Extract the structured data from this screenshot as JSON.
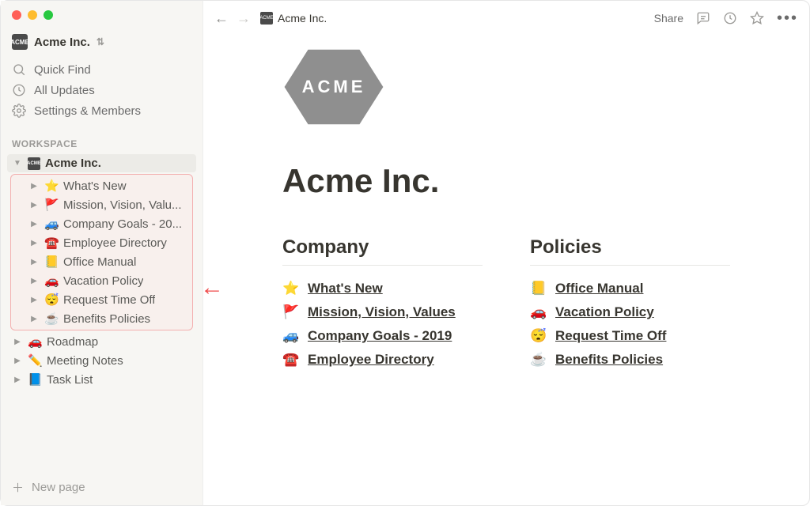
{
  "workspace_name": "Acme Inc.",
  "sidebar": {
    "quick_find": "Quick Find",
    "all_updates": "All Updates",
    "settings_members": "Settings & Members",
    "section_label": "WORKSPACE",
    "root": {
      "label": "Acme Inc."
    },
    "children": [
      {
        "emoji": "⭐",
        "label": "What's New"
      },
      {
        "emoji": "🚩",
        "label": "Mission, Vision, Valu..."
      },
      {
        "emoji": "🚙",
        "label": "Company Goals - 20..."
      },
      {
        "emoji": "☎️",
        "label": "Employee Directory"
      },
      {
        "emoji": "📒",
        "label": "Office Manual"
      },
      {
        "emoji": "🚗",
        "label": "Vacation Policy"
      },
      {
        "emoji": "😴",
        "label": "Request Time Off"
      },
      {
        "emoji": "☕",
        "label": "Benefits Policies"
      }
    ],
    "siblings": [
      {
        "emoji": "🚗",
        "label": "Roadmap"
      },
      {
        "emoji": "✏️",
        "label": "Meeting Notes"
      },
      {
        "emoji": "📘",
        "label": "Task List"
      }
    ],
    "new_page": "New page"
  },
  "topbar": {
    "breadcrumb": "Acme Inc.",
    "share": "Share"
  },
  "page": {
    "hero_text": "ACME",
    "title": "Acme Inc.",
    "columns": [
      {
        "heading": "Company",
        "links": [
          {
            "emoji": "⭐",
            "label": "What's New"
          },
          {
            "emoji": "🚩",
            "label": "Mission, Vision, Values"
          },
          {
            "emoji": "🚙",
            "label": "Company Goals - 2019"
          },
          {
            "emoji": "☎️",
            "label": "Employee Directory"
          }
        ]
      },
      {
        "heading": "Policies",
        "links": [
          {
            "emoji": "📒",
            "label": "Office Manual"
          },
          {
            "emoji": "🚗",
            "label": "Vacation Policy"
          },
          {
            "emoji": "😴",
            "label": "Request Time Off"
          },
          {
            "emoji": "☕",
            "label": "Benefits Policies"
          }
        ]
      }
    ]
  }
}
